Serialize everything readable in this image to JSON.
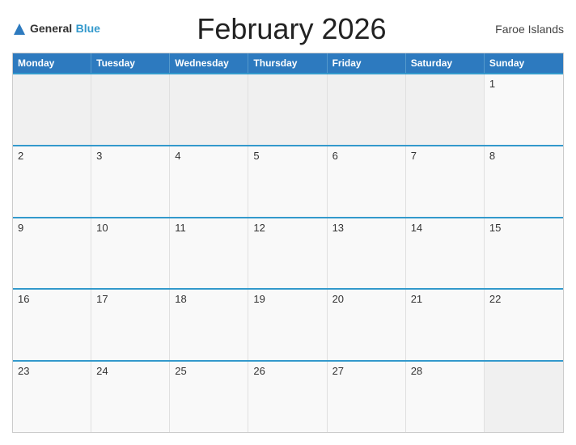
{
  "header": {
    "logo_general": "General",
    "logo_blue": "Blue",
    "month_title": "February 2026",
    "region": "Faroe Islands"
  },
  "calendar": {
    "day_headers": [
      "Monday",
      "Tuesday",
      "Wednesday",
      "Thursday",
      "Friday",
      "Saturday",
      "Sunday"
    ],
    "weeks": [
      [
        {
          "day": "",
          "empty": true
        },
        {
          "day": "",
          "empty": true
        },
        {
          "day": "",
          "empty": true
        },
        {
          "day": "",
          "empty": true
        },
        {
          "day": "",
          "empty": true
        },
        {
          "day": "",
          "empty": true
        },
        {
          "day": "1",
          "empty": false
        }
      ],
      [
        {
          "day": "2",
          "empty": false
        },
        {
          "day": "3",
          "empty": false
        },
        {
          "day": "4",
          "empty": false
        },
        {
          "day": "5",
          "empty": false
        },
        {
          "day": "6",
          "empty": false
        },
        {
          "day": "7",
          "empty": false
        },
        {
          "day": "8",
          "empty": false
        }
      ],
      [
        {
          "day": "9",
          "empty": false
        },
        {
          "day": "10",
          "empty": false
        },
        {
          "day": "11",
          "empty": false
        },
        {
          "day": "12",
          "empty": false
        },
        {
          "day": "13",
          "empty": false
        },
        {
          "day": "14",
          "empty": false
        },
        {
          "day": "15",
          "empty": false
        }
      ],
      [
        {
          "day": "16",
          "empty": false
        },
        {
          "day": "17",
          "empty": false
        },
        {
          "day": "18",
          "empty": false
        },
        {
          "day": "19",
          "empty": false
        },
        {
          "day": "20",
          "empty": false
        },
        {
          "day": "21",
          "empty": false
        },
        {
          "day": "22",
          "empty": false
        }
      ],
      [
        {
          "day": "23",
          "empty": false
        },
        {
          "day": "24",
          "empty": false
        },
        {
          "day": "25",
          "empty": false
        },
        {
          "day": "26",
          "empty": false
        },
        {
          "day": "27",
          "empty": false
        },
        {
          "day": "28",
          "empty": false
        },
        {
          "day": "",
          "empty": true
        }
      ]
    ]
  }
}
